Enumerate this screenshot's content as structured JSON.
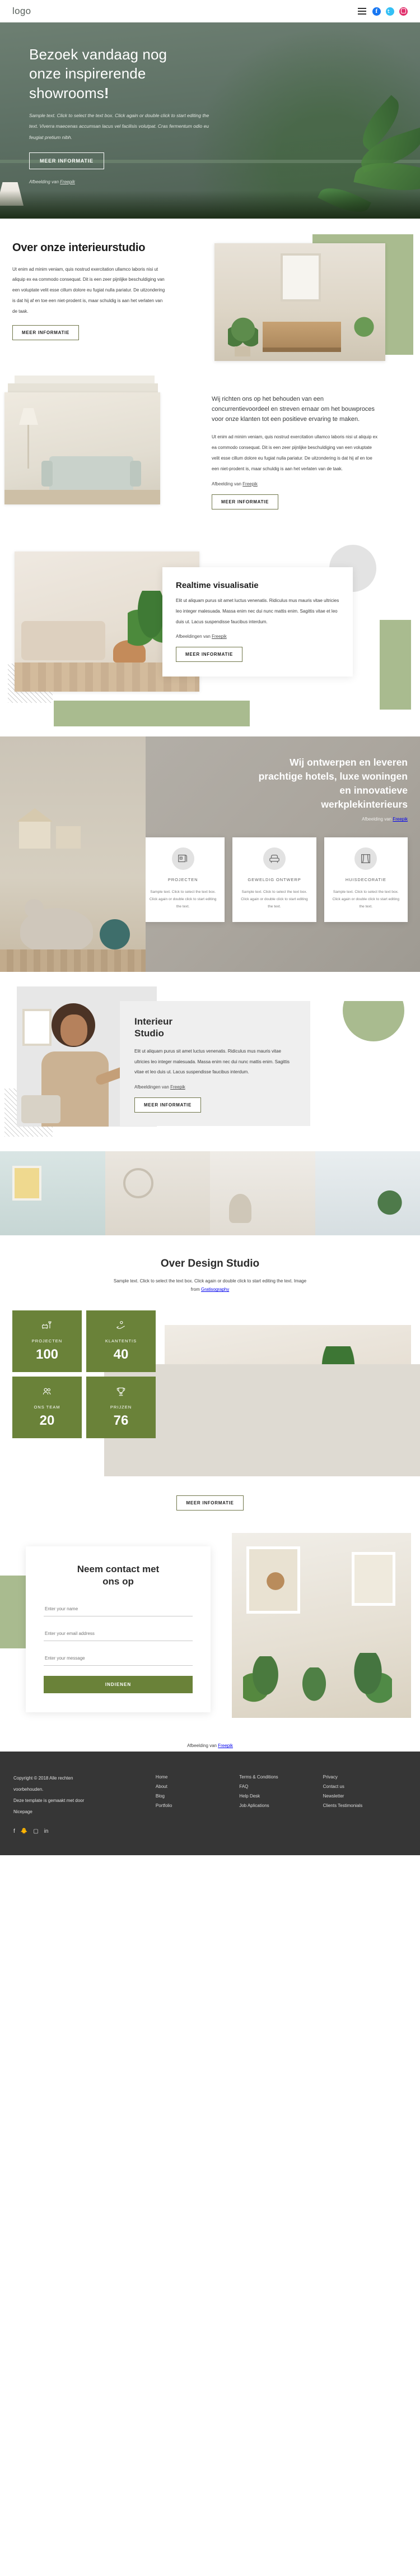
{
  "topbar": {
    "logo": "logo",
    "menu_icon": "hamburger-icon",
    "social": [
      "facebook-icon",
      "twitter-icon",
      "instagram-icon"
    ]
  },
  "hero": {
    "title_line1": "Bezoek vandaag nog",
    "title_line2": "onze inspirerende",
    "title_line3": "showrooms",
    "title_bang": "!",
    "paragraph": "Sample text. Click to select the text box. Click again or double click to start editing the text. Viverra maecenas accumsan lacus vel facilisis volutpat. Cras fermentum odio eu feugiat pretium nibh.",
    "button": "MEER INFORMATIE",
    "credit_prefix": "Afbeelding van ",
    "credit_link": "Freepik"
  },
  "about": {
    "title": "Over onze interieurstudio",
    "paragraph": "Ut enim ad minim veniam, quis nostrud exercitation ullamco laboris nisi ut aliquip ex ea commodo consequat. Dit is een zeer pijnlijke beschuldiging van een voluptate velit esse cillum dolore eu fugiat nulla pariatur. De uitzondering is dat hij af en toe een niet-prodent is, maar schuldig is aan het verlaten van de taak.",
    "button": "MEER INFORMATIE"
  },
  "mission": {
    "lead": "Wij richten ons op het behouden van een concurrentievoordeel en streven ernaar om het bouwproces voor onze klanten tot een positieve ervaring te maken.",
    "paragraph": "Ut enim ad minim veniam, quis nostrud exercitation ullamco laboris nisi ut aliquip ex ea commodo consequat. Dit is een zeer pijnlijke beschuldiging van een voluptate velit esse cillum dolore eu fugiat nulla pariatur. De uitzondering is dat hij af en toe een niet-prodent is, maar schuldig is aan het verlaten van de taak.",
    "credit_prefix": "Afbeelding van ",
    "credit_link": "Freepik",
    "button": "MEER INFORMATIE"
  },
  "realtime": {
    "title": "Realtime visualisatie",
    "paragraph": "Elit ut aliquam purus sit amet luctus venenatis. Ridiculus mus mauris vitae ultricies leo integer malesuada. Massa enim nec dui nunc mattis enim. Sagittis vitae et leo duis ut. Lacus suspendisse faucibus interdum.",
    "credit_prefix": "Afbeeldingen van ",
    "credit_link": "Freepik",
    "button": "MEER INFORMATIE"
  },
  "banner": {
    "title_line1": "Wij ontwerpen en leveren",
    "title_line2": "prachtige hotels, luxe woningen",
    "title_line3": "en innovatieve",
    "title_line4": "werkplekinterieurs",
    "credit_prefix": "Afbeelding van ",
    "credit_link": "Freepik",
    "cards": [
      {
        "icon": "blueprint-icon",
        "title": "PROJECTEN",
        "text": "Sample text. Click to select the text box. Click again or double click to start editing the text."
      },
      {
        "icon": "armchair-icon",
        "title": "GEWELDIG ONTWERP",
        "text": "Sample text. Click to select the text box. Click again or double click to start editing the text."
      },
      {
        "icon": "curtain-icon",
        "title": "HUISDECORATIE",
        "text": "Sample text. Click to select the text box. Click again or double click to start editing the text."
      }
    ]
  },
  "studio": {
    "title_line1": "Interieur",
    "title_line2": "Studio",
    "paragraph": "Elit ut aliquam purus sit amet luctus venenatis. Ridiculus mus mauris vitae ultricies leo integer malesuada. Massa enim nec dui nunc mattis enim. Sagittis vitae et leo duis ut. Lacus suspendisse faucibus interdum.",
    "credit_prefix": "Afbeeldingen van ",
    "credit_link": "Freepik",
    "button": "MEER INFORMATIE"
  },
  "design_studio": {
    "title": "Over Design Studio",
    "subtitle": "Sample text. Click to select the text box. Click again or double click to start editing the text. Image",
    "credit_prefix": "from ",
    "credit_link": "Gratisography",
    "button": "MEER INFORMATIE",
    "stats": [
      {
        "icon": "armchair-lamp-icon",
        "label": "PROJECTEN",
        "value": "100"
      },
      {
        "icon": "handshake-icon",
        "label": "KLANTENTIS",
        "value": "40"
      },
      {
        "icon": "team-icon",
        "label": "ONS TEAM",
        "value": "20"
      },
      {
        "icon": "trophy-icon",
        "label": "PRIJZEN",
        "value": "76"
      }
    ]
  },
  "contact": {
    "title_line1": "Neem contact met",
    "title_line2": "ons op",
    "name_placeholder": "Enter your name",
    "email_placeholder": "Enter your email address",
    "message_placeholder": "Enter your message",
    "submit": "INDIENEN",
    "credit_prefix": "Afbeelding van ",
    "credit_link": "Freepik"
  },
  "footer": {
    "copyright_line1": "Copyright © 2018 Alle rechten",
    "copyright_line2": "voorbehouden.",
    "copyright_line3": "Deze template is gemaakt met door",
    "copyright_line4": "Nicepage",
    "col1": [
      "Home",
      "About",
      "Blog",
      "Portfolio"
    ],
    "col2": [
      "Terms & Conditions",
      "FAQ",
      "Help Desk",
      "Job Aplications"
    ],
    "col3": [
      "Privacy",
      "Contact us",
      "Newsletter",
      "Clients Testimonials"
    ],
    "social": [
      "facebook-icon",
      "twitter-icon",
      "instagram-icon",
      "linkedin-icon"
    ]
  },
  "colors": {
    "accent_green": "#6a8239",
    "sage": "#a9bb8f",
    "hero_green": "#5e7165",
    "banner_grey": "#aba69e",
    "footer_dark": "#363636"
  }
}
